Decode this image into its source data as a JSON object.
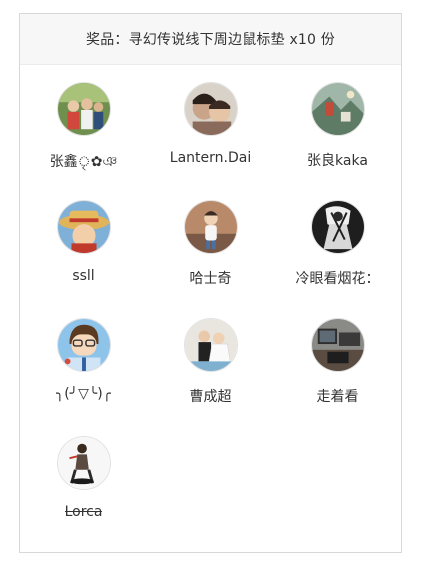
{
  "prize": {
    "title": "奖品：寻幻传说线下周边鼠标垫 x10 份"
  },
  "winners": [
    {
      "name": "张鑫ৃ✿ঞ",
      "avatar": "group-photo-avatar",
      "struck": false
    },
    {
      "name": "Lantern.Dai",
      "avatar": "couple-photo-avatar",
      "struck": false
    },
    {
      "name": "张良kaka",
      "avatar": "painting-avatar",
      "struck": false
    },
    {
      "name": "ssll",
      "avatar": "straw-hat-anime-avatar",
      "struck": false
    },
    {
      "name": "哈士奇",
      "avatar": "child-photo-avatar",
      "struck": false
    },
    {
      "name": "冷眼看烟花：",
      "avatar": "ink-sketch-avatar",
      "struck": false
    },
    {
      "name": "╮(╯▽╰)╭",
      "avatar": "cartoon-boy-avatar",
      "struck": false
    },
    {
      "name": "曹成超",
      "avatar": "wedding-photo-avatar",
      "struck": false
    },
    {
      "name": "走着看",
      "avatar": "office-photo-avatar",
      "struck": false
    },
    {
      "name": "Lorca",
      "avatar": "sketch-figure-avatar",
      "struck": true
    }
  ]
}
